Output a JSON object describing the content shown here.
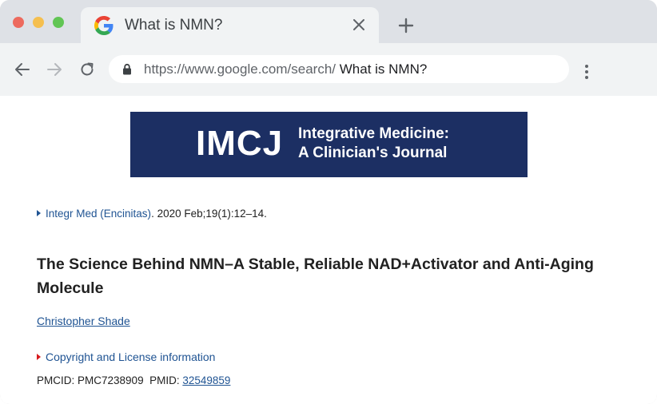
{
  "browser": {
    "tab": {
      "title": "What is NMN?",
      "favicon": "google-g-icon"
    },
    "address_bar": {
      "url_base": "https://www.google.com/search/",
      "url_query": " What is NMN?"
    },
    "colors": {
      "tabstrip_bg": "#dee1e6",
      "toolbar_bg": "#f1f3f4",
      "close": "#ed6a5e",
      "minimize": "#f5bf4f",
      "maximize": "#61c554"
    }
  },
  "page": {
    "banner": {
      "logo_text": "IMCJ",
      "subtitle_line1": "Integrative Medicine:",
      "subtitle_line2": "A Clinician's Journal",
      "bg_color": "#1c2f63"
    },
    "citation": {
      "journal": "Integr Med (Encinitas)",
      "details": ". 2020 Feb;19(1):12–14."
    },
    "article_title": "The Science Behind NMN–A Stable, Reliable NAD+Activator and Anti-Aging Molecule",
    "author": "Christopher Shade",
    "copyright_link": "Copyright and License information",
    "ids": {
      "pmcid_label": "PMCID: ",
      "pmcid": "PMC7238909",
      "pmid_label": "PMID: ",
      "pmid": "32549859"
    },
    "link_color": "#205493"
  }
}
